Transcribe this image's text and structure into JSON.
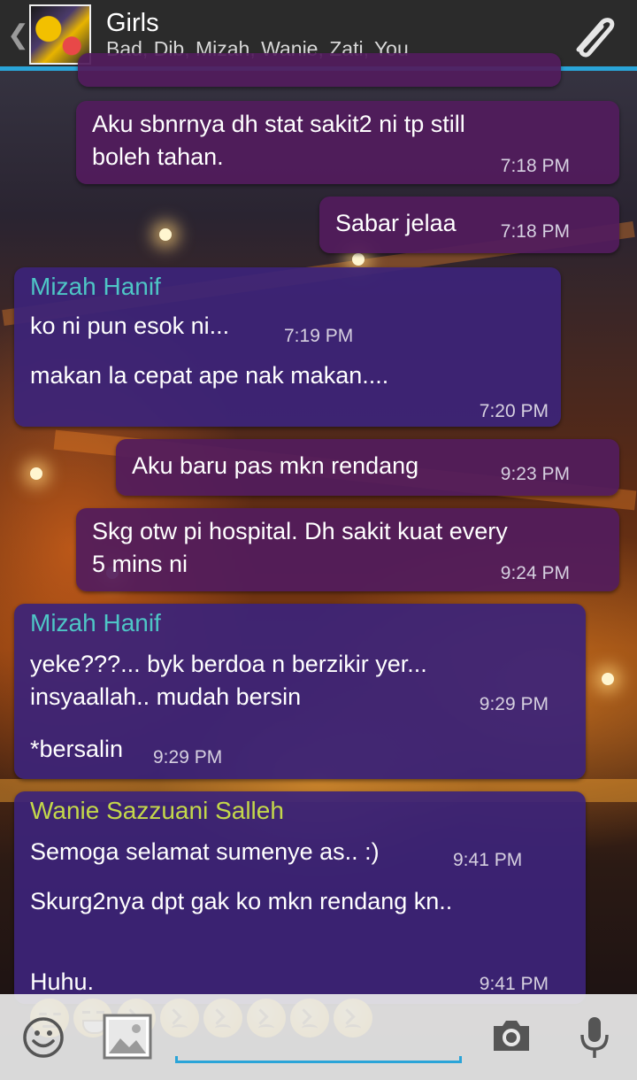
{
  "header": {
    "back_glyph": "❮",
    "title": "Girls",
    "members": "Bad, Dib, Mizah, Wanie, Zati, You"
  },
  "colors": {
    "accent": "#2aa4d8",
    "sender_mizah": "#4ec6c6",
    "sender_wanie": "#c4d84a",
    "bubble_out": "#521c5c",
    "bubble_in": "#3c2478"
  },
  "icons": {
    "back": "chevron-left-icon",
    "attach": "paperclip-icon",
    "emoji": "smiley-icon",
    "gallery": "image-icon",
    "camera": "camera-icon",
    "mic": "microphone-icon"
  },
  "messages": [
    {
      "direction": "out",
      "text": "Aku sbnrnya dh stat sakit2 ni tp still\nboleh tahan.",
      "time": "7:18 PM"
    },
    {
      "direction": "out",
      "text": "Sabar jelaa",
      "time": "7:18 PM"
    },
    {
      "direction": "in",
      "sender": "Mizah Hanif",
      "lines": [
        {
          "text": "ko ni pun esok ni...",
          "time": "7:19 PM"
        },
        {
          "text": "makan la cepat ape nak makan....",
          "time": "7:20 PM"
        }
      ]
    },
    {
      "direction": "out",
      "text": "Aku baru pas mkn rendang",
      "time": "9:23 PM"
    },
    {
      "direction": "out",
      "text": "Skg otw pi hospital. Dh sakit kuat every\n5 mins ni",
      "time": "9:24 PM"
    },
    {
      "direction": "in",
      "sender": "Mizah Hanif",
      "lines": [
        {
          "text": "yeke???... byk berdoa n berzikir yer...\ninsyaallah.. mudah bersin",
          "time": "9:29 PM"
        },
        {
          "text": "*bersalin",
          "time": "9:29 PM"
        }
      ]
    },
    {
      "direction": "in",
      "sender": "Wanie Sazzuani Salleh",
      "lines": [
        {
          "text": "Semoga selamat sumenye as.. :)",
          "time": "9:41 PM"
        },
        {
          "text": "Skurg2nya dpt gak ko mkn rendang kn..",
          "time": ""
        },
        {
          "text": "Huhu.",
          "time": "9:41 PM",
          "emojis": [
            "pensive",
            "sweat-smile",
            "persevere",
            "persevere",
            "persevere",
            "persevere",
            "persevere",
            "persevere"
          ]
        }
      ]
    }
  ],
  "composer": {
    "placeholder": ""
  }
}
